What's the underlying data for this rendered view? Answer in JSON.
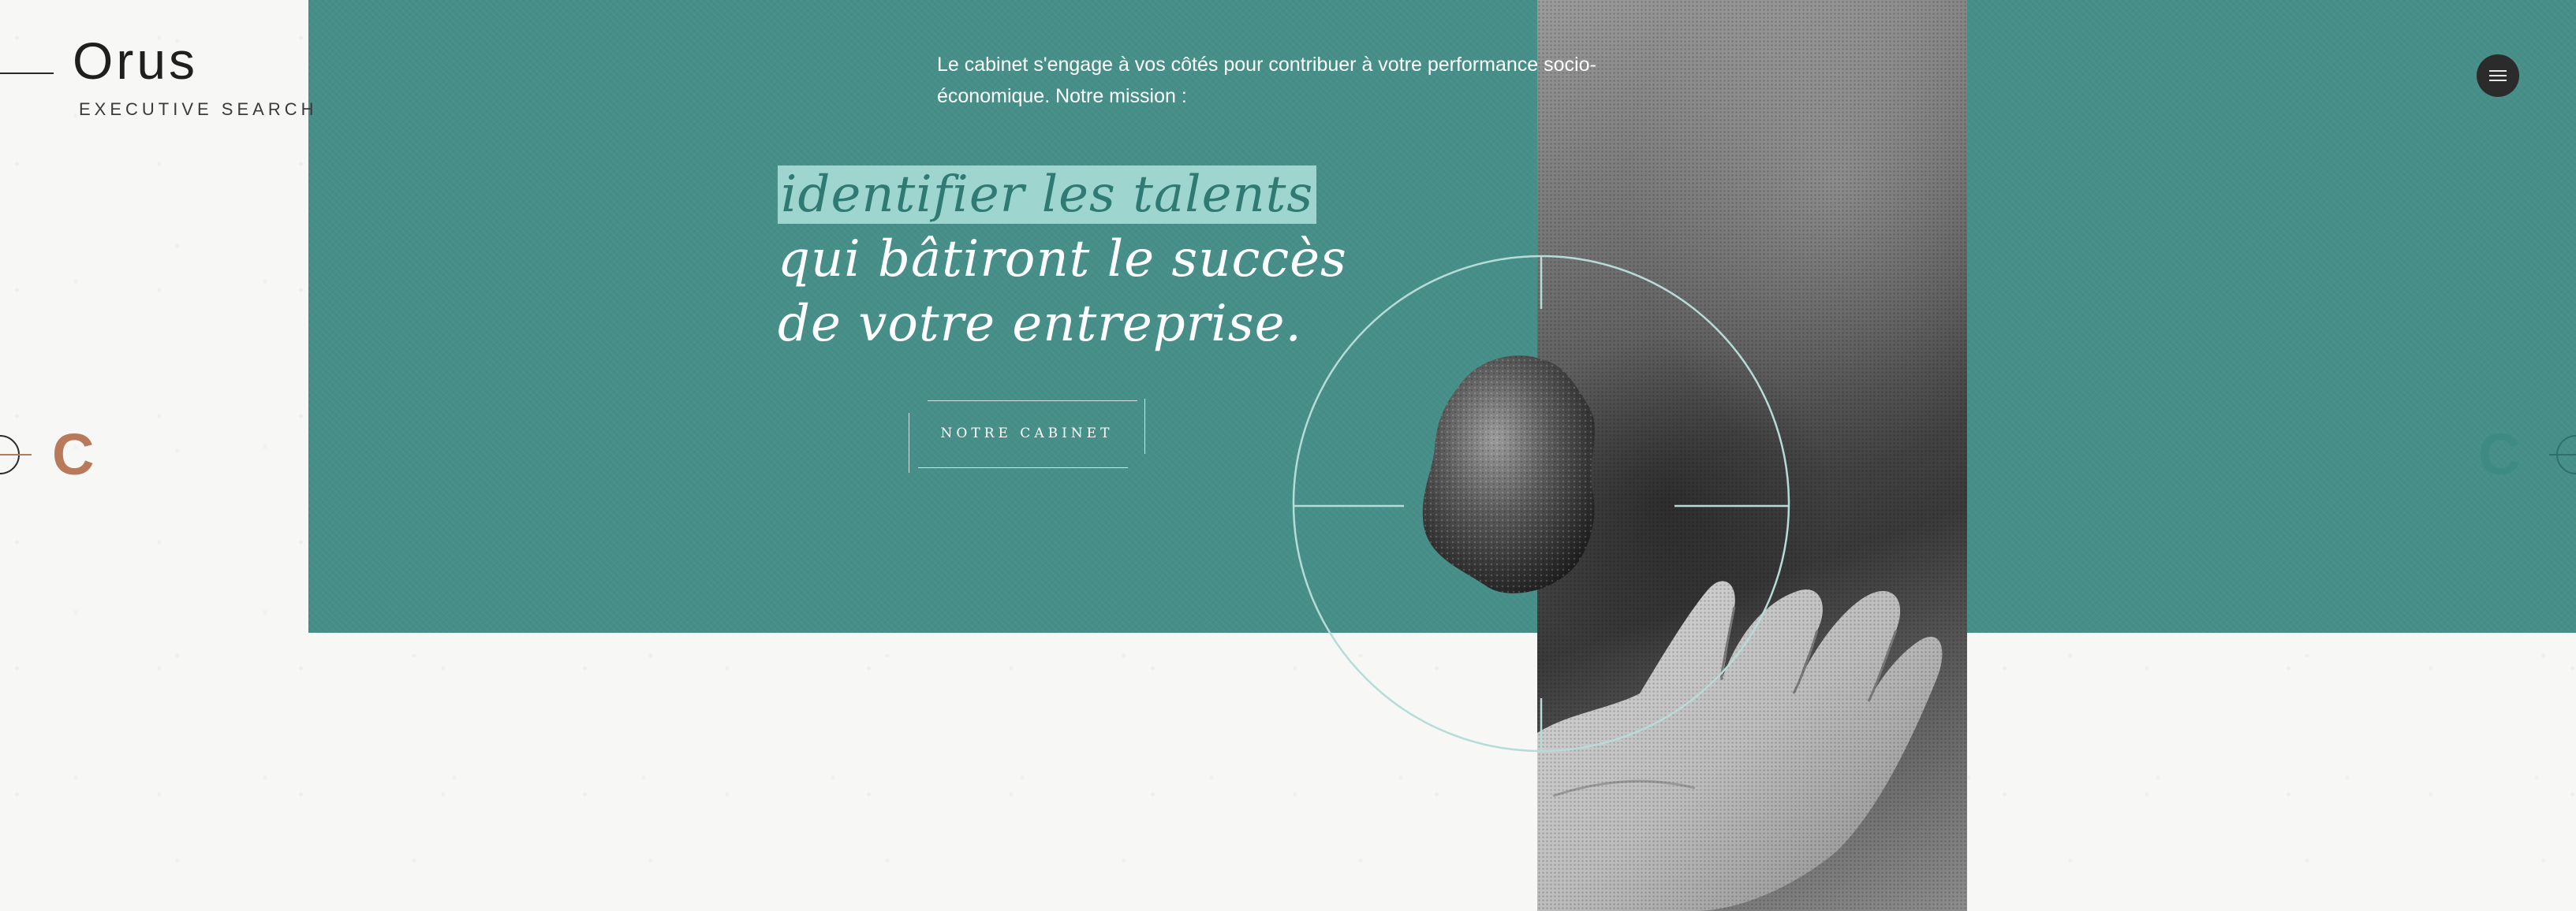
{
  "brand": {
    "logo_word": "Orus",
    "logo_subtitle": "EXECUTIVE SEARCH"
  },
  "hero": {
    "intro_line1": "Le cabinet s'engage à vos côtés pour contribuer à votre performance socio-",
    "intro_line2": "économique. Notre mission :",
    "headline_highlight": "identifier les talents",
    "headline_line2": "qui bâtiront le succès",
    "headline_line3": "de votre entreprise.",
    "cta_label": "NOTRE CABINET"
  },
  "side_nav": {
    "prev_letter": "C",
    "next_letter": "C"
  },
  "icons": {
    "menu": "hamburger-menu-icon",
    "target": "crosshair-circle-icon"
  },
  "colors": {
    "teal_band": "#468f88",
    "highlight": "#9ed6cf",
    "prev_accent": "#b97a5c",
    "next_accent": "#3e8b83",
    "menu_button": "#2b2b2b"
  }
}
